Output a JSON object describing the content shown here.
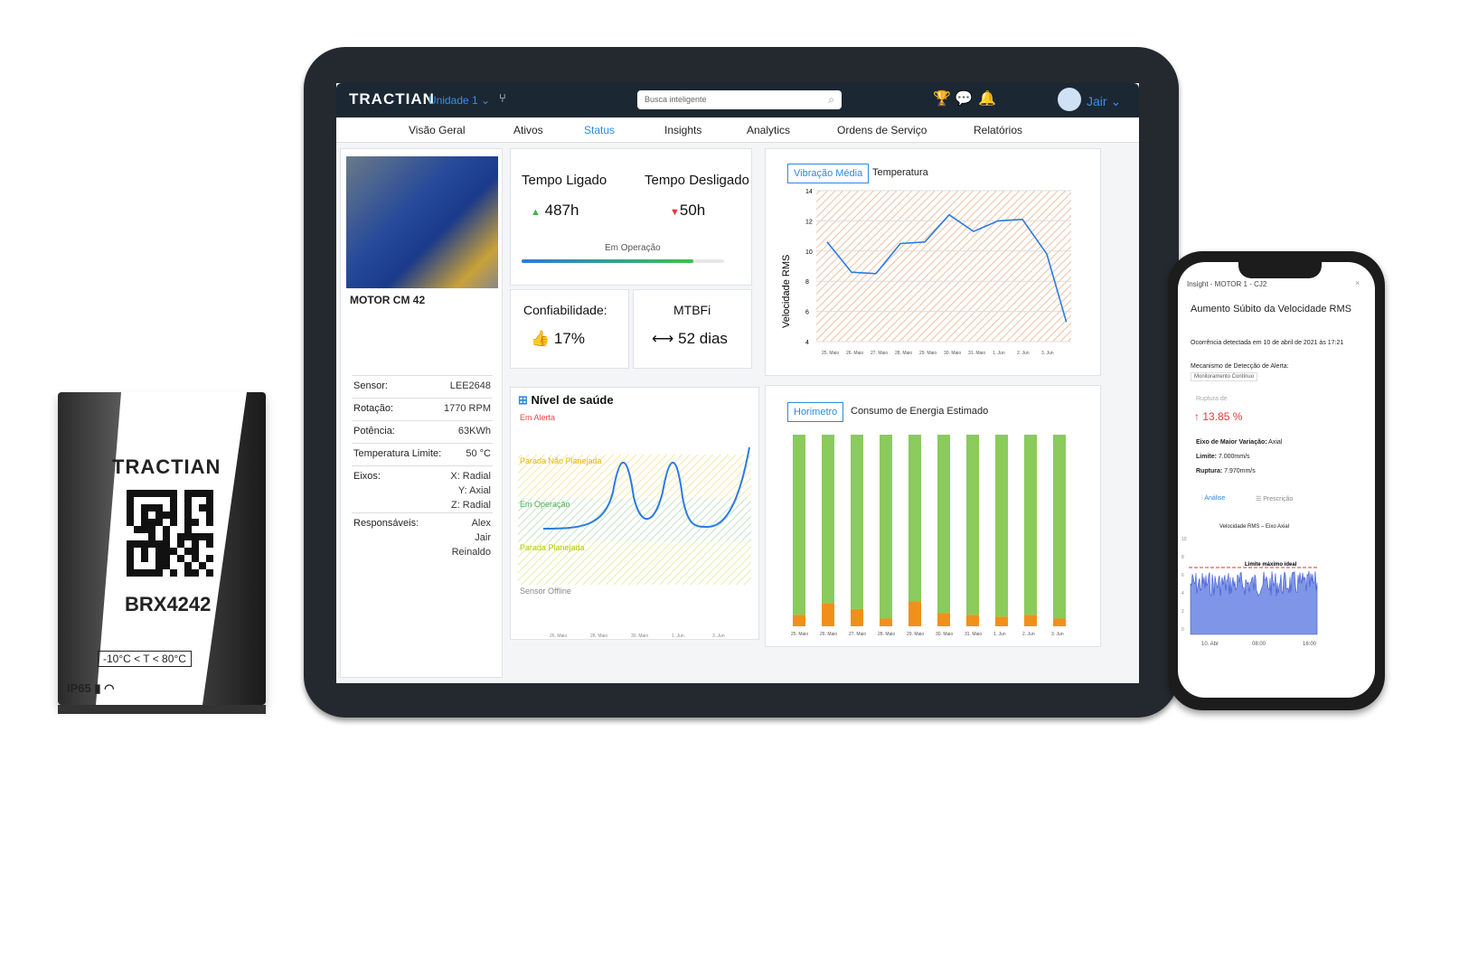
{
  "sensor": {
    "brand": "TRACTIAN",
    "id": "BRX4242",
    "temp_range": "-10°C < T < 80°C",
    "ip": "IP65"
  },
  "app": {
    "logo": "TRACTIAN",
    "unit": "Unidade 1",
    "search_placeholder": "Busca inteligente",
    "user": "Jair"
  },
  "nav": [
    "Visão Geral",
    "Ativos",
    "Status",
    "Insights",
    "Analytics",
    "Ordens de Serviço",
    "Relatórios"
  ],
  "asset": {
    "name": "MOTOR CM 42",
    "props": [
      {
        "label": "Sensor:",
        "value": "LEE2648"
      },
      {
        "label": "Rotação:",
        "value": "1770 RPM"
      },
      {
        "label": "Potência:",
        "value": "63KWh"
      },
      {
        "label": "Temperatura Limite:",
        "value": "50 °C"
      },
      {
        "label": "Eixos:",
        "value": "X: Radial"
      },
      {
        "label": "",
        "value": "Y: Axial"
      },
      {
        "label": "",
        "value": "Z: Radial"
      },
      {
        "label": "Responsáveis:",
        "value": "Alex"
      },
      {
        "label": "",
        "value": "Jair"
      },
      {
        "label": "",
        "value": "Reinaldo"
      }
    ]
  },
  "uptime": {
    "on_label": "Tempo Ligado",
    "on_value": "487h",
    "off_label": "Tempo Desligado",
    "off_value": "50h",
    "status": "Em Operação",
    "progress": 0.85
  },
  "reliability": {
    "label": "Confiabilidade:",
    "value": "17%"
  },
  "mtbf": {
    "label": "MTBFi",
    "value": "52 dias"
  },
  "health": {
    "title": "Nível de saúde",
    "bands": [
      "Em Alerta",
      "Parada Não Planejada",
      "Em Operação",
      "Parada Planejada",
      "Sensor Offline"
    ],
    "band_colors": [
      "#e44",
      "#e6b800",
      "#4caf50",
      "#b5c900",
      "#888"
    ],
    "ticks": [
      "26. Maio",
      "28. Maio",
      "30. Maio",
      "1. Jun",
      "3. Jun"
    ]
  },
  "vibration": {
    "tabs": [
      "Vibração Média",
      "Temperatura"
    ],
    "ylabel": "Velocidade RMS"
  },
  "energy": {
    "tabs": [
      "Horimetro",
      "Consumo de Energia Estimado"
    ]
  },
  "chart_data": [
    {
      "type": "line",
      "ylabel": "Velocidade RMS",
      "ylim": [
        4,
        14
      ],
      "yticks": [
        14,
        12,
        10,
        8,
        6,
        4
      ],
      "categories": [
        "25. Maio",
        "26. Maio",
        "27. Maio",
        "28. Maio",
        "29. Maio",
        "30. Maio",
        "31. Maio",
        "1. Jun",
        "2. Jun",
        "3. Jun"
      ],
      "x": [
        0,
        1,
        2,
        3,
        4,
        5,
        6,
        7,
        8,
        9,
        9.8
      ],
      "values": [
        10.6,
        8.6,
        8.5,
        10.5,
        10.6,
        12.4,
        11.3,
        12.0,
        12.1,
        9.8,
        5.3
      ]
    },
    {
      "type": "bar",
      "categories": [
        "25. Maio",
        "26. Maio",
        "27. Maio",
        "28. Maio",
        "29. Maio",
        "30. Maio",
        "31. Maio",
        "1. Jun",
        "2. Jun",
        "3. Jun"
      ],
      "series": [
        {
          "values": [
            6,
            12,
            9,
            4,
            13,
            7,
            6,
            5,
            6,
            4
          ]
        },
        {
          "values": [
            94,
            88,
            91,
            96,
            87,
            93,
            94,
            95,
            94,
            96
          ]
        }
      ],
      "colors": [
        "#f0901b",
        "#8acb5c"
      ]
    },
    {
      "type": "line",
      "title": "Velocidade RMS – Eixo Axial",
      "categories": [
        "10. Abr",
        "08:00",
        "16:00"
      ],
      "yticks": [
        10,
        8,
        6,
        4,
        2,
        0
      ],
      "annotation": "Limite máximo ideal",
      "threshold": 7.0
    }
  ],
  "phone": {
    "header": "Insight - MOTOR 1 - CJ2",
    "title": "Aumento Súbito da Velocidade RMS",
    "occ": "Ocorrência detectada em 10 de abril de 2021 às 17:21",
    "mech_label": "Mecanismo de Detecção de Alerta:",
    "mech_value": "Monitoramento Contínuo",
    "rupture_label": "Ruptura de",
    "rupture_value": "13.85 %",
    "axis_label": "Eixo de Maior Variação:",
    "axis_value": "Axial",
    "limit_label": "Limite:",
    "limit_value": "7.000mm/s",
    "rupt_label": "Ruptura:",
    "rupt_value": "7.970mm/s",
    "tab1": "Análise",
    "tab2": "Prescrição",
    "chart_title": "Velocidade RMS – Eixo Axial",
    "annot": "Limite máximo ideal",
    "x1": "10. Abr",
    "x2": "08:00",
    "x3": "16:00"
  }
}
